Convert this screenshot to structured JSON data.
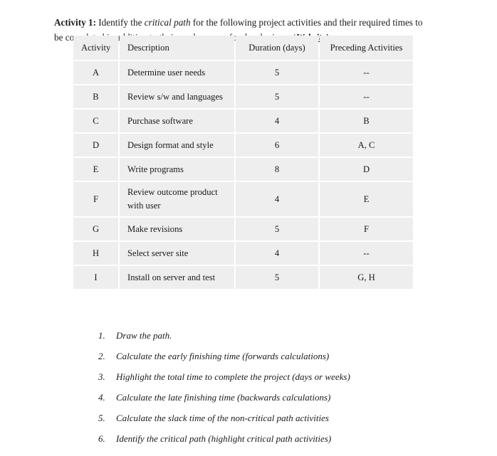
{
  "intro": {
    "lead_label": "Activity 1:",
    "text_part_1": " Identify the ",
    "emphasis_1": "critical path",
    "text_part_2": " for the following project activities and their required times to be completed in addition to their predecessors for developing a ‘",
    "emphasis_2": "Website",
    "text_part_3": "’:"
  },
  "table": {
    "columns": [
      "Activity",
      "Description",
      "Duration (days)",
      "Preceding Activities"
    ],
    "rows": [
      {
        "activity": "A",
        "description": "Determine user needs",
        "duration": "5",
        "preceding": "--"
      },
      {
        "activity": "B",
        "description": "Review s/w and languages",
        "duration": "5",
        "preceding": "--"
      },
      {
        "activity": "C",
        "description": "Purchase software",
        "duration": "4",
        "preceding": "B"
      },
      {
        "activity": "D",
        "description": "Design format and style",
        "duration": "6",
        "preceding": "A, C"
      },
      {
        "activity": "E",
        "description": "Write programs",
        "duration": "8",
        "preceding": "D"
      },
      {
        "activity": "F",
        "description": "Review outcome product with user",
        "duration": "4",
        "preceding": "E"
      },
      {
        "activity": "G",
        "description": "Make revisions",
        "duration": "5",
        "preceding": "F"
      },
      {
        "activity": "H",
        "description": "Select server site",
        "duration": "4",
        "preceding": "--"
      },
      {
        "activity": "I",
        "description": "Install on server and test",
        "duration": "5",
        "preceding": "G, H"
      }
    ]
  },
  "tasks": [
    {
      "num": "1.",
      "text": "Draw the path."
    },
    {
      "num": "2.",
      "text": "Calculate the early finishing time (forwards calculations)"
    },
    {
      "num": "3.",
      "text": "Highlight the total time to complete the project (days or weeks)"
    },
    {
      "num": "4.",
      "text": "Calculate the late finishing time (backwards calculations)"
    },
    {
      "num": "5.",
      "text": "Calculate the slack time of the non-critical path activities"
    },
    {
      "num": "6.",
      "text": "Identify the critical path (highlight critical path activities)"
    }
  ],
  "colors": {
    "page_background": "#ffffff",
    "table_cell_background": "#eeeeee",
    "cell_gap": "#ffffff",
    "text": "#1a1a1a"
  }
}
